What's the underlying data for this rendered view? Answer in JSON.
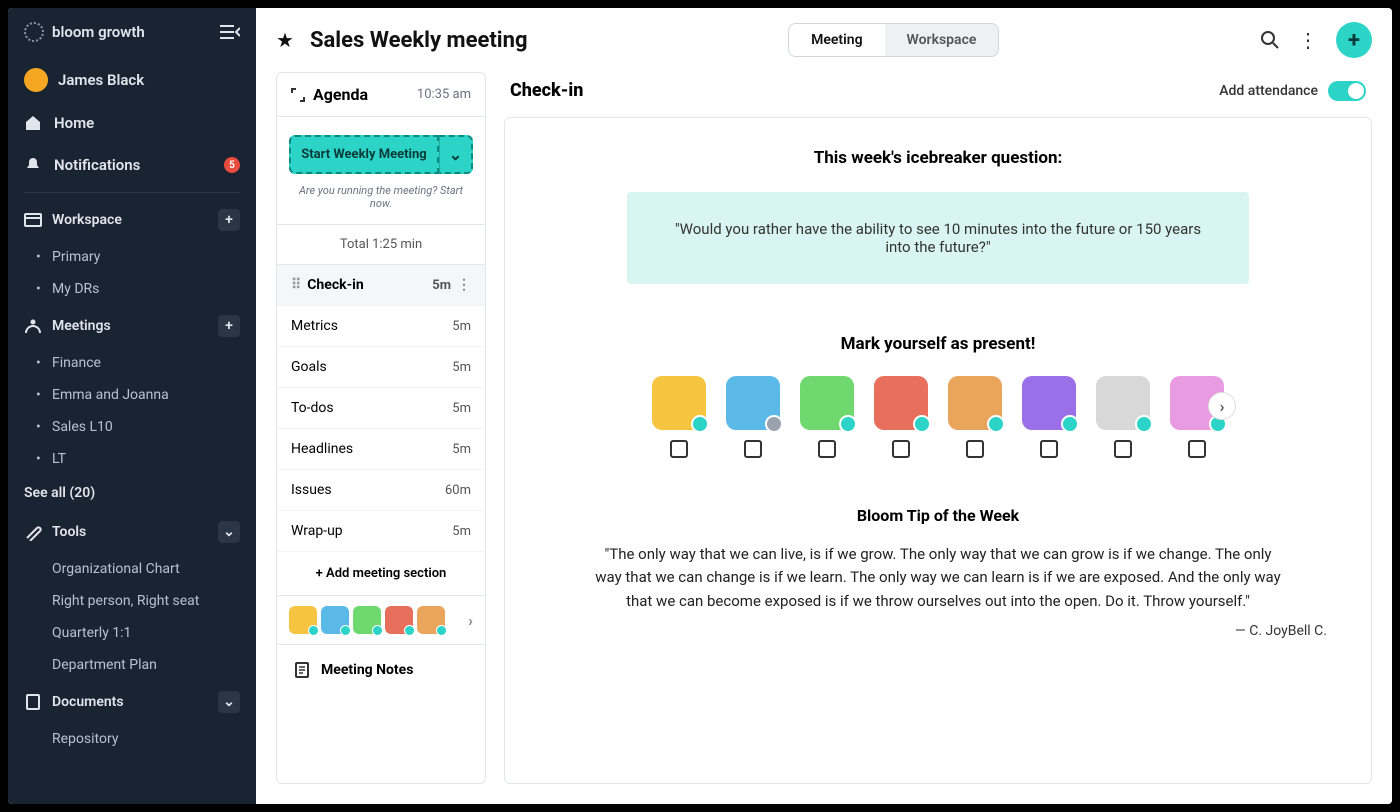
{
  "brand": {
    "name": "bloom growth"
  },
  "user": {
    "name": "James Black"
  },
  "nav": {
    "home": "Home",
    "notifications": "Notifications",
    "notif_count": "5",
    "workspace": "Workspace",
    "workspace_items": [
      "Primary",
      "My DRs"
    ],
    "meetings": "Meetings",
    "meeting_items": [
      "Finance",
      "Emma and Joanna",
      "Sales L10",
      "LT"
    ],
    "see_all": "See all (20)",
    "tools": "Tools",
    "tool_items": [
      "Organizational Chart",
      "Right person, Right seat",
      "Quarterly 1:1",
      "Department Plan"
    ],
    "documents": "Documents",
    "doc_items": [
      "Repository"
    ]
  },
  "header": {
    "title": "Sales Weekly meeting",
    "tab_meeting": "Meeting",
    "tab_workspace": "Workspace"
  },
  "agenda": {
    "title": "Agenda",
    "time": "10:35 am",
    "start_btn": "Start Weekly Meeting",
    "hint": "Are you running the meeting? Start now.",
    "total": "Total 1:25 min",
    "items": [
      {
        "label": "Check-in",
        "dur": "5m",
        "active": true
      },
      {
        "label": "Metrics",
        "dur": "5m"
      },
      {
        "label": "Goals",
        "dur": "5m"
      },
      {
        "label": "To-dos",
        "dur": "5m"
      },
      {
        "label": "Headlines",
        "dur": "5m"
      },
      {
        "label": "Issues",
        "dur": "60m"
      },
      {
        "label": "Wrap-up",
        "dur": "5m"
      }
    ],
    "add_section": "+ Add meeting section",
    "notes": "Meeting Notes",
    "mini_colors": [
      "#f5c542",
      "#5bb9e8",
      "#6fd86f",
      "#e86f5b",
      "#e8a55b"
    ]
  },
  "checkin": {
    "title": "Check-in",
    "attendance_label": "Add attendance",
    "icebreaker_heading": "This week's icebreaker question:",
    "icebreaker_q": "\"Would you rather have the ability to see 10 minutes into the future or 150 years into the future?\"",
    "present_heading": "Mark yourself as present!",
    "people_colors": [
      "#f5c542",
      "#5bb9e8",
      "#6fd86f",
      "#e86f5b",
      "#e8a55b",
      "#9b6fe8",
      "#d8d8d8",
      "#e89be0"
    ],
    "tip_heading": "Bloom Tip of the Week",
    "tip_quote": "\"The only way that we can live, is if we grow. The only way that we can grow is if we change. The only way that we can change is if we learn. The only way we can learn is if we are exposed. And the only way that we can become exposed is if we throw ourselves out into the open. Do it. Throw yourself.\"",
    "tip_author": "— C. JoyBell C."
  }
}
